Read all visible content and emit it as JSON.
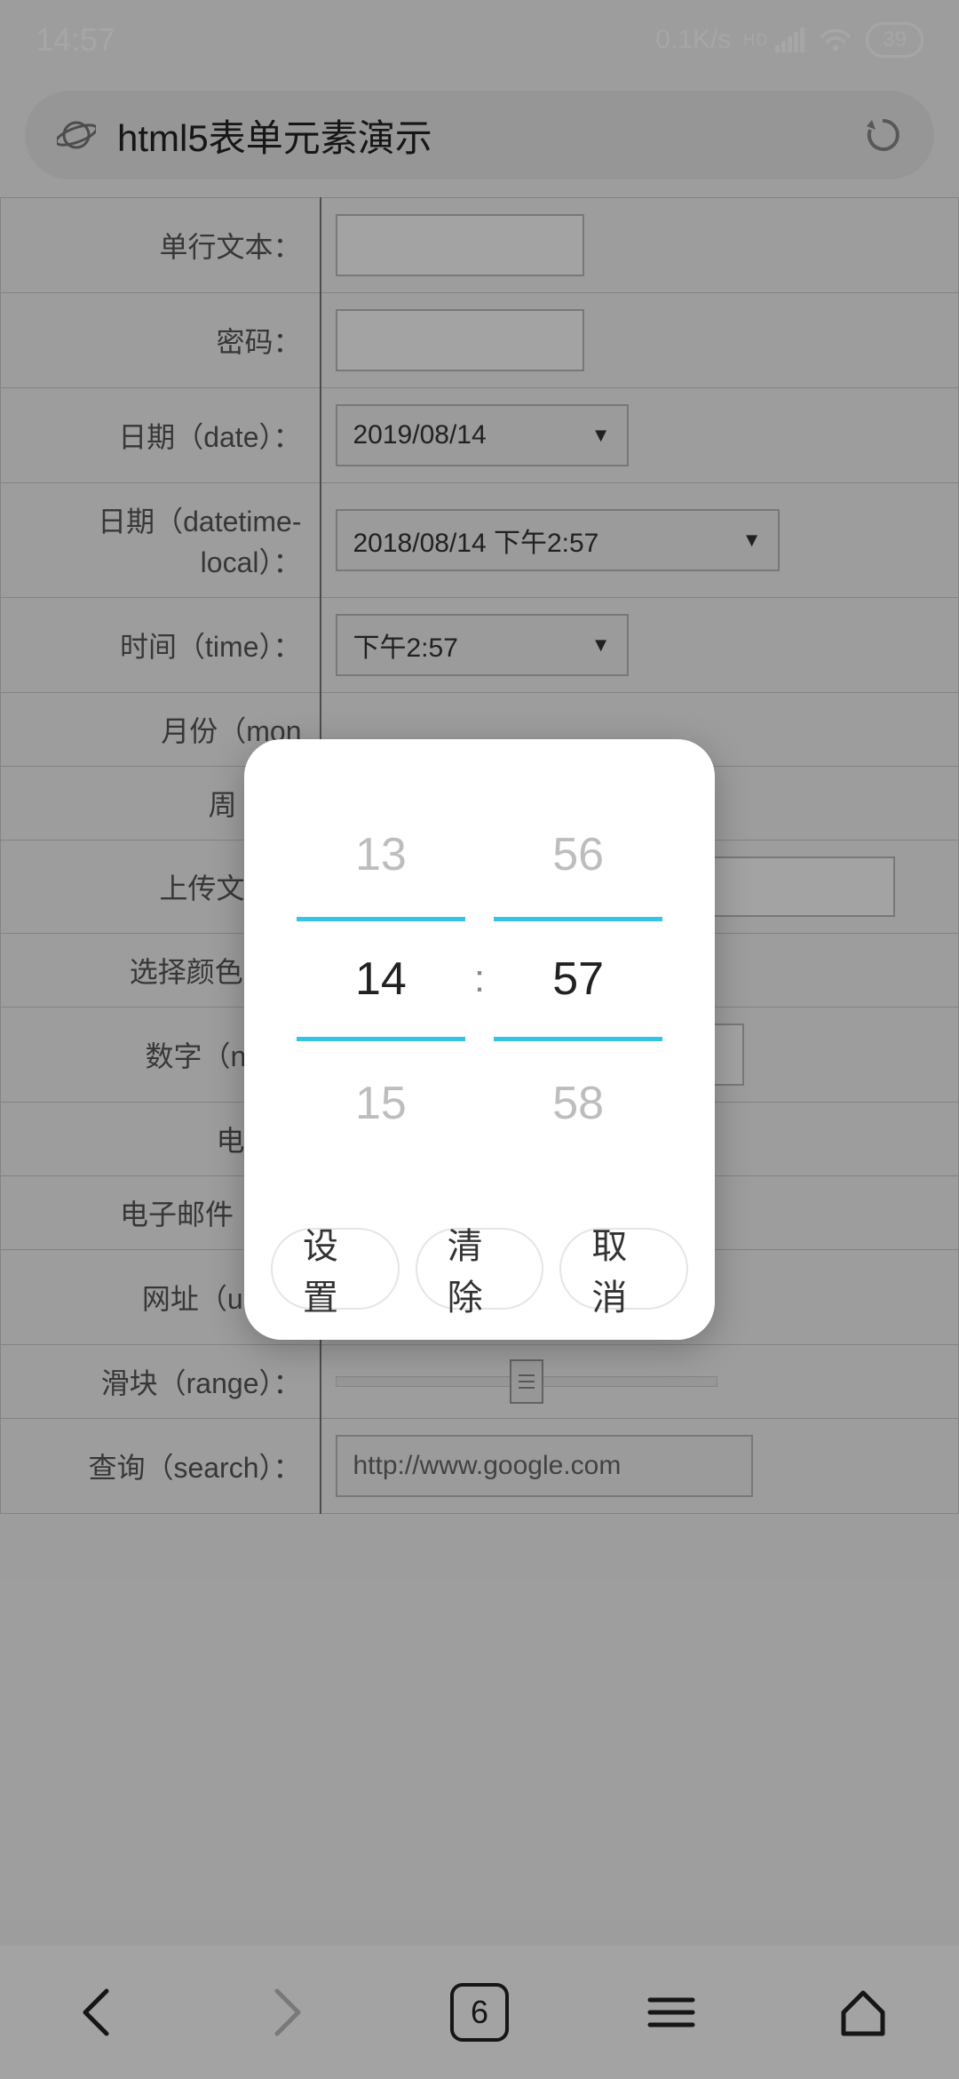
{
  "statusbar": {
    "time": "14:57",
    "net_speed": "0.1K/s",
    "hd": "HD",
    "battery": "39"
  },
  "urlbar": {
    "title": "html5表单元素演示"
  },
  "form": {
    "rows": [
      {
        "label": "单行文本：",
        "kind": "text",
        "value": ""
      },
      {
        "label": "密码：",
        "kind": "text",
        "value": ""
      },
      {
        "label": "日期（date）：",
        "kind": "select",
        "value": "2019/08/14",
        "w": "w-small"
      },
      {
        "label": "日期（datetime-local）：",
        "kind": "select",
        "value": "2018/08/14 下午2:57",
        "w": "w-med"
      },
      {
        "label": "时间（time）：",
        "kind": "select",
        "value": "下午2:57",
        "w": "w-small"
      },
      {
        "label": "月份（mon",
        "kind": "hidden"
      },
      {
        "label": "周（we",
        "kind": "hidden"
      },
      {
        "label": "上传文件（",
        "kind": "file"
      },
      {
        "label": "选择颜色（co",
        "kind": "hidden"
      },
      {
        "label": "数字（numb",
        "kind": "num"
      },
      {
        "label": "电话（",
        "kind": "hidden"
      },
      {
        "label": "电子邮件（em",
        "kind": "hidden"
      },
      {
        "label": "网址（url）：",
        "kind": "url"
      },
      {
        "label": "滑块（range）：",
        "kind": "range"
      },
      {
        "label": "查询（search）：",
        "kind": "search",
        "value": "http://www.google.com"
      }
    ]
  },
  "dialog": {
    "hour_prev": "13",
    "hour": "14",
    "hour_next": "15",
    "minute_prev": "56",
    "minute": "57",
    "minute_next": "58",
    "btn_set": "设置",
    "btn_clear": "清除",
    "btn_cancel": "取消"
  },
  "bottomnav": {
    "tab_count": "6"
  }
}
